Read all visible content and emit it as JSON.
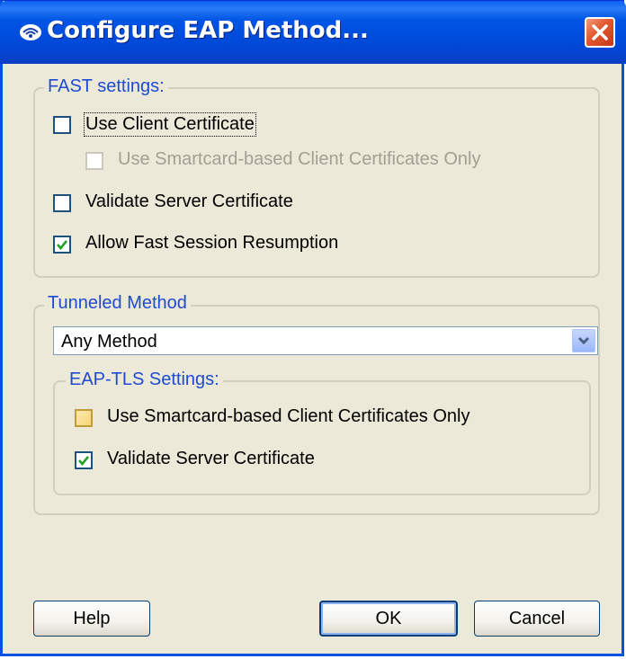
{
  "window": {
    "title": "Configure EAP Method..."
  },
  "fast_settings": {
    "legend": "FAST settings:",
    "use_client_certificate": {
      "label": "Use Client Certificate",
      "checked": false
    },
    "use_smartcard_only": {
      "label": "Use Smartcard-based Client Certificates Only",
      "checked": false,
      "disabled": true
    },
    "validate_server_certificate": {
      "label": "Validate Server Certificate",
      "checked": false
    },
    "allow_fast_session_resumption": {
      "label": "Allow Fast Session Resumption",
      "checked": true
    }
  },
  "tunneled_method": {
    "legend": "Tunneled Method",
    "selected": "Any Method"
  },
  "eap_tls_settings": {
    "legend": "EAP-TLS Settings:",
    "use_smartcard_only": {
      "label": "Use Smartcard-based Client Certificates Only",
      "checked": false
    },
    "validate_server_certificate": {
      "label": "Validate Server Certificate",
      "checked": true
    }
  },
  "buttons": {
    "help": "Help",
    "ok": "OK",
    "cancel": "Cancel"
  },
  "colors": {
    "titlebar": "#0055e5",
    "group_title": "#1e4bd1",
    "background": "#ece9d8"
  }
}
